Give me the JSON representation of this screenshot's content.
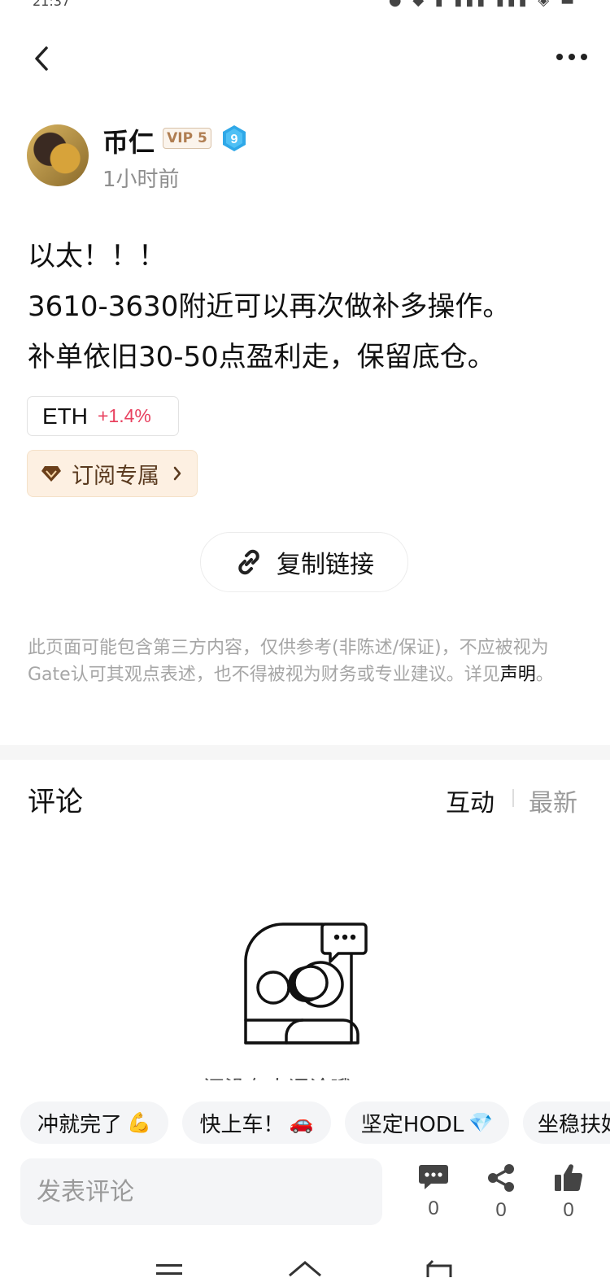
{
  "status_bar": {
    "time": "21:37",
    "network_speed": "KB/s"
  },
  "author": {
    "name": "币仁",
    "vip": "VIP 5",
    "level": "9",
    "time_ago": "1小时前"
  },
  "post": {
    "lines": [
      "以太！！！",
      "3610-3630附近可以再次做补多操作。",
      "补单依旧30-50点盈利走，保留底仓。"
    ]
  },
  "coin_tag": {
    "symbol": "ETH",
    "change": "+1.4%"
  },
  "subscribe": {
    "label": "订阅专属"
  },
  "copy_link": {
    "label": "复制链接"
  },
  "disclaimer": {
    "text": "此页面可能包含第三方内容，仅供参考(非陈述/保证)，不应被视为Gate认可其观点表述，也不得被视为财务或专业建议。详见",
    "link": "声明",
    "end": "。"
  },
  "comments": {
    "title": "评论",
    "sort_active": "互动",
    "sort_inactive": "最新",
    "empty_text": "还没有人评论哦"
  },
  "quick_replies": [
    {
      "text": "冲就完了",
      "emoji": "💪"
    },
    {
      "text": "快上车！",
      "emoji": "🚗"
    },
    {
      "text": "坚定HODL",
      "emoji": "💎"
    },
    {
      "text": "坐稳扶好",
      "emoji": ""
    }
  ],
  "bottom_bar": {
    "placeholder": "发表评论",
    "comment_count": "0",
    "share_count": "0",
    "like_count": "0"
  },
  "colors": {
    "accent_red": "#e8415f",
    "vip_brown": "#b07e52",
    "level_blue": "#2fa8e8"
  }
}
